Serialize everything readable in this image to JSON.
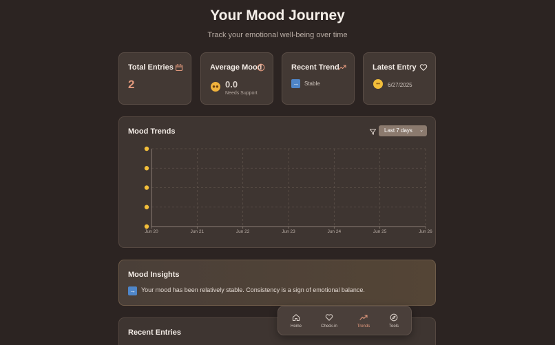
{
  "header": {
    "title": "Your Mood Journey",
    "subtitle": "Track your emotional well-being over time"
  },
  "stats": {
    "total": {
      "title": "Total Entries",
      "value": "2",
      "icon": "calendar-icon"
    },
    "average": {
      "title": "Average Mood",
      "value": "0.0",
      "status": "Needs Support",
      "emoji": "😠",
      "icon": "info-icon"
    },
    "trend": {
      "title": "Recent Trend",
      "value": "Stable",
      "emoji": "➡",
      "icon": "trending-up-icon"
    },
    "latest": {
      "title": "Latest Entry",
      "date": "6/27/2025",
      "emoji": "😊",
      "icon": "heart-icon"
    }
  },
  "mood_trends": {
    "title": "Mood Trends",
    "range_selected": "Last 7 days",
    "filter_icon": "filter-icon"
  },
  "chart_data": {
    "type": "line",
    "title": "Mood Trends",
    "x": [
      "Jun 20",
      "Jun 21",
      "Jun 22",
      "Jun 23",
      "Jun 24",
      "Jun 25",
      "Jun 26"
    ],
    "y_levels": 5,
    "y_tick_glyph": "emoji",
    "series": [],
    "grid": true
  },
  "insights": {
    "title": "Mood Insights",
    "text": "Your mood has been relatively stable. Consistency is a sign of emotional balance.",
    "emoji": "➡"
  },
  "recent": {
    "title": "Recent Entries"
  },
  "nav": {
    "items": [
      {
        "label": "Home",
        "icon": "home-icon",
        "active": false
      },
      {
        "label": "Check-in",
        "icon": "heart-icon",
        "active": false
      },
      {
        "label": "Trends",
        "icon": "trending-up-icon",
        "active": true
      },
      {
        "label": "Tools",
        "icon": "compass-icon",
        "active": false
      }
    ]
  },
  "colors": {
    "background": "#2c2422",
    "card": "#433934",
    "accent": "#e39a7e",
    "emoji_yellow": "#f2be3a"
  }
}
